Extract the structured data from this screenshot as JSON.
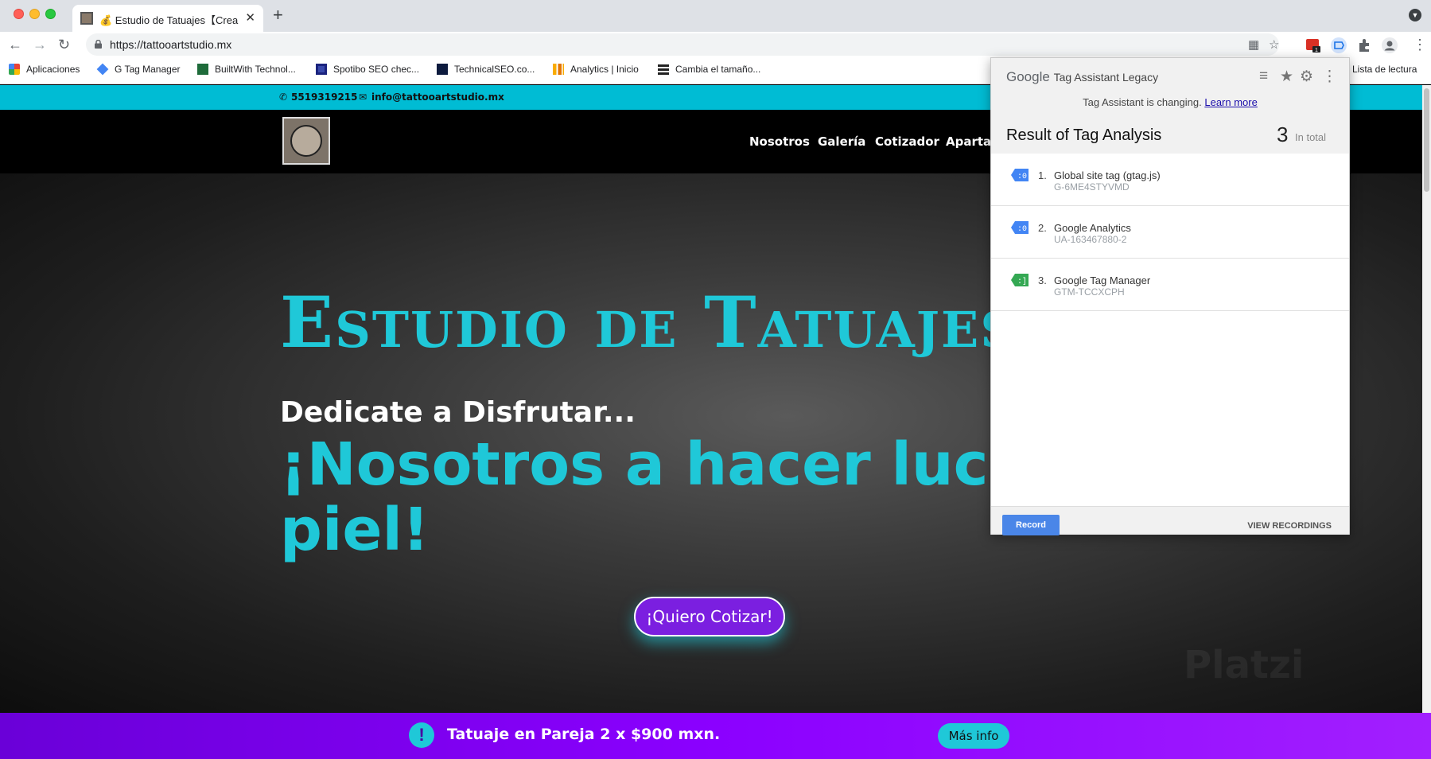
{
  "browser": {
    "tab_title": "💰 Estudio de Tatuajes【Crear",
    "new_tab": "+",
    "close": "✕",
    "url": "https://tattooartstudio.mx",
    "bookmarks": [
      "Aplicaciones",
      "G Tag Manager",
      "BuiltWith Technol...",
      "Spotibo SEO chec...",
      "TechnicalSEO.co...",
      "Analytics | Inicio",
      "Cambia el tamaño..."
    ],
    "reading_list": "Lista de lectura",
    "extension_badge": "1"
  },
  "site": {
    "phone": "5519319215",
    "email": "info@tattooartstudio.mx",
    "nav": [
      "Nosotros",
      "Galería",
      "Cotizador",
      "Apartad"
    ],
    "hero_title": "Estudio de Tatuajes",
    "hero_sub": "Dedicate a Disfrutar...",
    "hero_big": "¡Nosotros a hacer lucir tu piel!",
    "cta": "¡Quiero Cotizar!",
    "watermark": "Platzi",
    "promo_text": "Tatuaje en Pareja 2 x $900 mxn.",
    "promo_button": "Más info"
  },
  "tag_assistant": {
    "brand_google": "Google",
    "brand_product": "Tag Assistant Legacy",
    "notice": "Tag Assistant is changing.",
    "learn_more": "Learn more",
    "result_title": "Result of Tag Analysis",
    "count": "3",
    "count_label": "In total",
    "tags": [
      {
        "num": "1.",
        "name": "Global site tag (gtag.js)",
        "id": "G-6ME4STYVMD",
        "color": "#4285f4"
      },
      {
        "num": "2.",
        "name": "Google Analytics",
        "id": "UA-163467880-2",
        "color": "#4285f4"
      },
      {
        "num": "3.",
        "name": "Google Tag Manager",
        "id": "GTM-TCCXCPH",
        "color": "#34a853"
      }
    ],
    "record": "Record",
    "view_recordings": "VIEW RECORDINGS"
  },
  "colors": {
    "accent_teal": "#1fc8d8",
    "promo_purple": "#8b00ff",
    "cta_purple": "#7b1fe0"
  }
}
